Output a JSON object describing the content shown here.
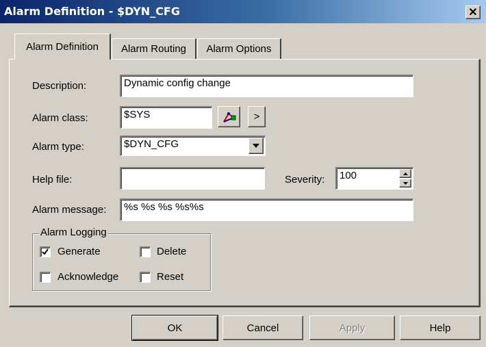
{
  "window": {
    "title": "Alarm Definition - $DYN_CFG",
    "close_glyph": "✕"
  },
  "tabs": [
    {
      "label": "Alarm Definition",
      "active": true
    },
    {
      "label": "Alarm Routing",
      "active": false
    },
    {
      "label": "Alarm Options",
      "active": false
    }
  ],
  "form": {
    "description": {
      "label": "Description:",
      "value": "Dynamic config change"
    },
    "alarm_class": {
      "label": "Alarm class:",
      "value": "$SYS",
      "browse_glyph": ">"
    },
    "alarm_type": {
      "label": "Alarm type:",
      "value": "$DYN_CFG"
    },
    "help_file": {
      "label": "Help file:",
      "value": ""
    },
    "severity": {
      "label": "Severity:",
      "value": "100"
    },
    "alarm_message": {
      "label": "Alarm message:",
      "value": "%s %s %s %s%s"
    }
  },
  "alarm_logging": {
    "legend": "Alarm Logging",
    "generate": {
      "label": "Generate",
      "checked": true
    },
    "delete": {
      "label": "Delete",
      "checked": false
    },
    "acknowledge": {
      "label": "Acknowledge",
      "checked": false
    },
    "reset": {
      "label": "Reset",
      "checked": false
    }
  },
  "buttons": {
    "ok": "OK",
    "cancel": "Cancel",
    "apply": "Apply",
    "help": "Help"
  },
  "colors": {
    "title_gradient_start": "#0a246a",
    "title_gradient_end": "#a6caf0",
    "face": "#d4d0c8",
    "disabled_text": "#808080"
  }
}
